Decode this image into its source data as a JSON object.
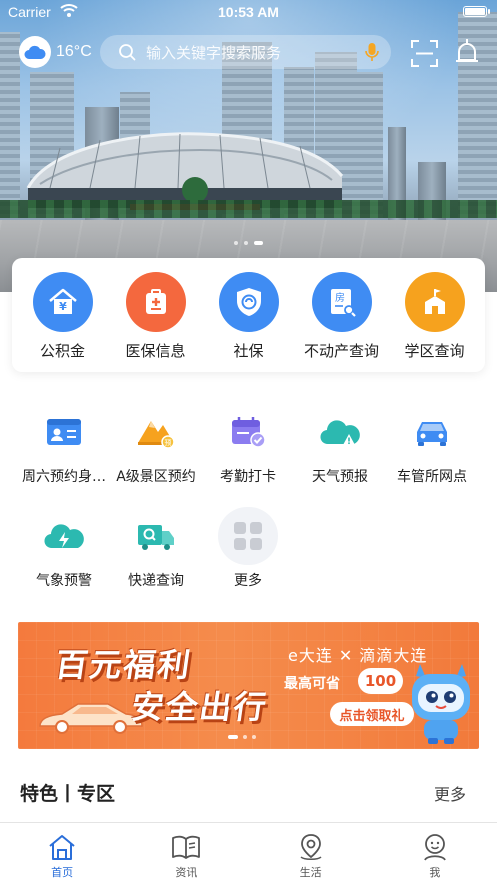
{
  "status_bar": {
    "carrier": "Carrier",
    "time": "10:53 AM"
  },
  "header": {
    "temperature": "16°C",
    "search_placeholder": "输入关键字搜索服务"
  },
  "hero": {
    "slide_count": 3,
    "active_slide": 3
  },
  "primary_services": [
    {
      "label": "公积金",
      "icon": "house-icon",
      "color": "#3f8cf3"
    },
    {
      "label": "医保信息",
      "icon": "medical-kit-icon",
      "color": "#f4683e"
    },
    {
      "label": "社保",
      "icon": "shield-icon",
      "color": "#3f8cf3"
    },
    {
      "label": "不动产查询",
      "icon": "property-document-icon",
      "color": "#3f8cf3"
    },
    {
      "label": "学区查询",
      "icon": "school-icon",
      "color": "#f6a21e"
    }
  ],
  "grid_services": [
    {
      "label": "周六预约身…",
      "icon": "id-card-icon"
    },
    {
      "label": "A级景区预约",
      "icon": "mountain-icon"
    },
    {
      "label": "考勤打卡",
      "icon": "calendar-check-icon"
    },
    {
      "label": "天气预报",
      "icon": "weather-alert-cloud-icon"
    },
    {
      "label": "车管所网点",
      "icon": "car-icon"
    },
    {
      "label": "气象预警",
      "icon": "lightning-cloud-icon"
    },
    {
      "label": "快递查询",
      "icon": "delivery-truck-icon"
    },
    {
      "label": "更多",
      "icon": "more-grid-icon"
    }
  ],
  "promo": {
    "title_line1": "百元福利",
    "title_line2": "安全出行",
    "partners": "e大连 ✕ 滴滴大连",
    "max_label": "最高可省",
    "amount": "100",
    "cta": "点击领取礼",
    "slide_count": 3,
    "active_slide": 1
  },
  "section": {
    "title": "特色丨专区",
    "more": "更多"
  },
  "tabs": [
    {
      "label": "首页",
      "icon": "home-icon",
      "active": true
    },
    {
      "label": "资讯",
      "icon": "news-book-icon",
      "active": false
    },
    {
      "label": "生活",
      "icon": "location-pin-icon",
      "active": false
    },
    {
      "label": "我",
      "icon": "profile-face-icon",
      "active": false
    }
  ]
}
